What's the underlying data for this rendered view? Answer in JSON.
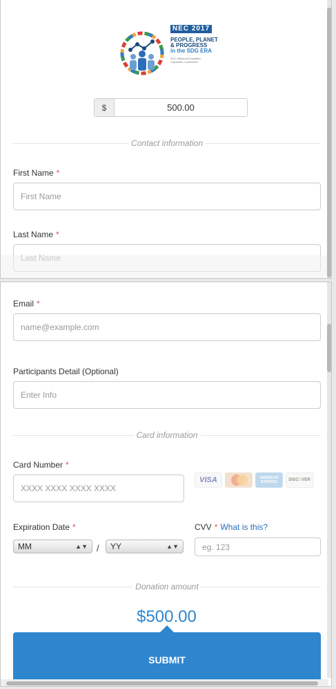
{
  "colors": {
    "accent": "#2e86cf",
    "required": "#d9534f",
    "link": "#2a6fb8"
  },
  "logo": {
    "badge": "NEC 2017",
    "line1": "PEOPLE, PLANET",
    "line2": "& PROGRESS",
    "line3": "in the SDG ERA",
    "small1": "2017 National Evaluation",
    "small2": "Capacities Conference"
  },
  "amount": {
    "currency_symbol": "$",
    "value": "500.00"
  },
  "sections": {
    "contact": "Contact information",
    "card": "Card information",
    "donation": "Donation amount"
  },
  "fields": {
    "first_name": {
      "label": "First Name",
      "required": "*",
      "placeholder": "First Name"
    },
    "last_name": {
      "label": "Last Name",
      "required": "*",
      "placeholder": "Last Name"
    },
    "email": {
      "label": "Email",
      "required": "*",
      "placeholder": "name@example.com"
    },
    "participants": {
      "label": "Participants Detail (Optional)",
      "placeholder": "Enter Info"
    },
    "card_number": {
      "label": "Card Number",
      "required": "*",
      "placeholder": "XXXX XXXX XXXX XXXX"
    },
    "expiration": {
      "label": "Expiration Date",
      "required": "*",
      "month": "MM",
      "year": "YY",
      "separator": "/"
    },
    "cvv": {
      "label": "CVV",
      "required": "*",
      "link": "What is this?",
      "placeholder": "eg. 123"
    }
  },
  "card_brands": {
    "visa": "VISA",
    "amex_line1": "AMERICAN",
    "amex_line2": "EXPRESS",
    "discover_a": "DISC",
    "discover_b": "O",
    "discover_c": "VER",
    "icons": [
      "visa-card-icon",
      "mastercard-card-icon",
      "amex-card-icon",
      "discover-card-icon"
    ]
  },
  "donation": {
    "amount_display": "$500.00",
    "submit_label": "SUBMIT"
  },
  "scroll": {
    "top_panel_fraction": 0.84,
    "bottom_panel_fraction": 0.12
  }
}
